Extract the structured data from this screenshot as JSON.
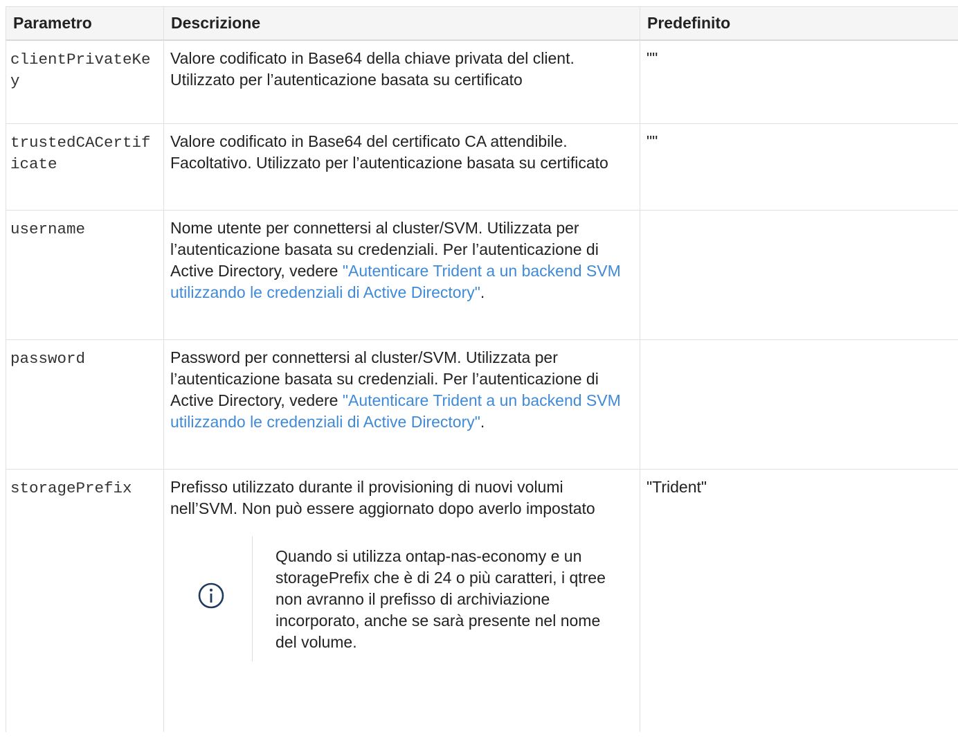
{
  "table": {
    "headers": [
      "Parametro",
      "Descrizione",
      "Predefinito"
    ],
    "rows": [
      {
        "param": "clientPrivateKey",
        "desc": "Valore codificato in Base64 della chiave privata del client. Utilizzato per l’autenticazione basata su certificato",
        "default": "\"\""
      },
      {
        "param": "trustedCACertificate",
        "desc": "Valore codificato in Base64 del certificato CA attendibile. Facoltativo. Utilizzato per l’autenticazione basata su certificato",
        "default": "\"\""
      },
      {
        "param": "username",
        "desc": "Nome utente per connettersi al cluster/SVM. Utilizzata per l’autenticazione basata su credenziali. Per l’autenticazione di Active Directory, vedere",
        "link": "\"Autenticare Trident a un backend SVM utilizzando le credenziali di Active Directory\"",
        "after": ".",
        "default": ""
      },
      {
        "param": "password",
        "desc": "Password per connettersi al cluster/SVM. Utilizzata per l’autenticazione basata su credenziali. Per l’autenticazione di Active Directory, vedere",
        "link": "\"Autenticare Trident a un backend SVM utilizzando le credenziali di Active Directory\"",
        "after": ".",
        "default": ""
      },
      {
        "param": "storagePrefix",
        "desc": "Prefisso utilizzato durante il provisioning di nuovi volumi nell’SVM. Non può essere aggiornato dopo averlo impostato",
        "note": "Quando si utilizza ontap-nas-economy e un storagePrefix che è di 24 o più caratteri, i qtree non avranno il prefisso di archiviazione incorporato, anche se sarà presente nel nome del volume.",
        "note_icon": "info-icon",
        "default": "\"Trident\""
      }
    ]
  },
  "colors": {
    "link": "#3f8ad8",
    "header_bg": "#f5f5f5",
    "border": "#e0e0e0"
  }
}
